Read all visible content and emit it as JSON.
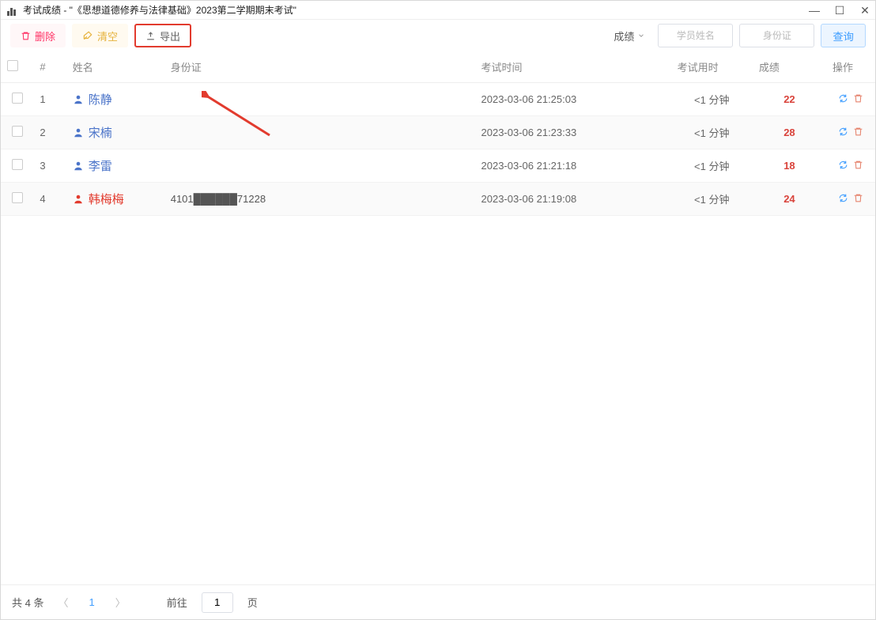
{
  "window": {
    "title": "考试成绩 -  \"《思想道德修养与法律基础》2023第二学期期末考试\""
  },
  "toolbar": {
    "delete": "删除",
    "clear": "清空",
    "export": "导出",
    "sortField": "成绩",
    "namePlaceholder": "学员姓名",
    "idPlaceholder": "身份证",
    "query": "查询"
  },
  "table": {
    "headers": {
      "index": "#",
      "name": "姓名",
      "idcard": "身份证",
      "examTime": "考试时间",
      "duration": "考试用时",
      "score": "成绩",
      "op": "操作"
    },
    "rows": [
      {
        "idx": "1",
        "name": "陈静",
        "red": false,
        "idcard": "",
        "time": "2023-03-06 21:25:03",
        "duration": "<1 分钟",
        "score": "22"
      },
      {
        "idx": "2",
        "name": "宋楠",
        "red": false,
        "idcard": "",
        "time": "2023-03-06 21:23:33",
        "duration": "<1 分钟",
        "score": "28"
      },
      {
        "idx": "3",
        "name": "李雷",
        "red": false,
        "idcard": "",
        "time": "2023-03-06 21:21:18",
        "duration": "<1 分钟",
        "score": "18"
      },
      {
        "idx": "4",
        "name": "韩梅梅",
        "red": true,
        "idcard": "4101██████71228",
        "time": "2023-03-06 21:19:08",
        "duration": "<1 分钟",
        "score": "24"
      }
    ]
  },
  "footer": {
    "total": "共 4 条",
    "page": "1",
    "goto_pre": "前往",
    "goto_val": "1",
    "goto_post": "页"
  }
}
